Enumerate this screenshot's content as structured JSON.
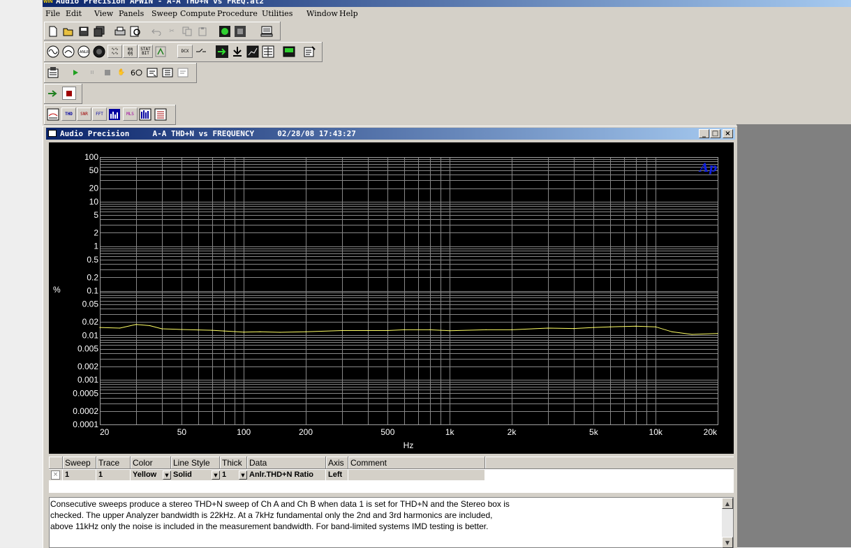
{
  "app": {
    "title": "Audio Precision APWIN - A-A THD+N vs FREQ.at2",
    "icon_text": "WIN"
  },
  "menu": [
    "File",
    "Edit",
    "View",
    "Panels",
    "Sweep",
    "Compute",
    "Procedure",
    "Utilities",
    "Window",
    "Help"
  ],
  "toolbar": {
    "row2_labels": [
      "ANLR",
      "DCX"
    ],
    "row5_labels": [
      "THD",
      "FFT",
      "MLS"
    ]
  },
  "child_window": {
    "title": "Audio Precision     A-A THD+N vs FREQUENCY     02/28/08 17:43:27",
    "minimize": "_",
    "restore": "□",
    "close": "×",
    "logo": "Ap"
  },
  "chart_data": {
    "type": "line",
    "title": "",
    "xlabel": "Hz",
    "ylabel": "%",
    "xscale": "log",
    "yscale": "log",
    "xlim": [
      20,
      20000
    ],
    "ylim": [
      0.0001,
      100
    ],
    "grid": true,
    "background": "#000000",
    "grid_color": "#888888",
    "x_ticks": [
      20,
      50,
      100,
      200,
      500,
      1000,
      2000,
      5000,
      10000,
      20000
    ],
    "x_tick_labels": [
      "20",
      "50",
      "100",
      "200",
      "500",
      "1k",
      "2k",
      "5k",
      "10k",
      "20k"
    ],
    "y_ticks": [
      100,
      50,
      20,
      10,
      5,
      2,
      1,
      0.5,
      0.2,
      0.1,
      0.05,
      0.02,
      0.01,
      0.005,
      0.002,
      0.001,
      0.0005,
      0.0002,
      0.0001
    ],
    "y_tick_labels": [
      "100",
      "50",
      "20",
      "10",
      "5",
      "2",
      "1",
      "0.5",
      "0.2",
      "0.1",
      "0.05",
      "0.02",
      "0.01",
      "0.005",
      "0.002",
      "0.001",
      "0.0005",
      "0.0002",
      "0.0001"
    ],
    "series": [
      {
        "color": "#ffff66",
        "x": [
          20,
          25,
          30,
          35,
          40,
          50,
          60,
          70,
          80,
          100,
          120,
          150,
          200,
          300,
          400,
          500,
          600,
          800,
          1000,
          1500,
          2000,
          3000,
          4000,
          5000,
          6000,
          8000,
          10000,
          12000,
          15000,
          20000
        ],
        "y": [
          0.015,
          0.0145,
          0.0175,
          0.0165,
          0.014,
          0.0135,
          0.0132,
          0.013,
          0.0125,
          0.0118,
          0.012,
          0.0117,
          0.012,
          0.0128,
          0.0128,
          0.0128,
          0.0133,
          0.0133,
          0.0127,
          0.0133,
          0.0133,
          0.0145,
          0.0142,
          0.015,
          0.0155,
          0.016,
          0.0155,
          0.012,
          0.0105,
          0.011
        ]
      }
    ]
  },
  "trace_table": {
    "headers": [
      "Sweep",
      "Trace",
      "Color",
      "Line Style",
      "Thick",
      "Data",
      "Axis",
      "Comment"
    ],
    "row": {
      "checkbox": "×",
      "sweep": "1",
      "trace": "1",
      "color": "Yellow",
      "line_style": "Solid",
      "thick": "1",
      "data": "Anlr.THD+N Ratio",
      "axis": "Left",
      "comment": ""
    },
    "dropdown_glyph": "▼"
  },
  "comment_text": [
    "Consecutive sweeps produce a stereo THD+N sweep of Ch A and Ch B when data 1 is set for THD+N and the Stereo box is",
    "checked.  The upper Analyzer bandwidth is 22kHz.  At a 7kHz fundamental only the 2nd and 3rd harmonics are included,",
    "above 11kHz only the noise is included in the measurement bandwidth.  For band-limited systems IMD testing is better."
  ],
  "scroll": {
    "up": "▲",
    "down": "▼"
  }
}
